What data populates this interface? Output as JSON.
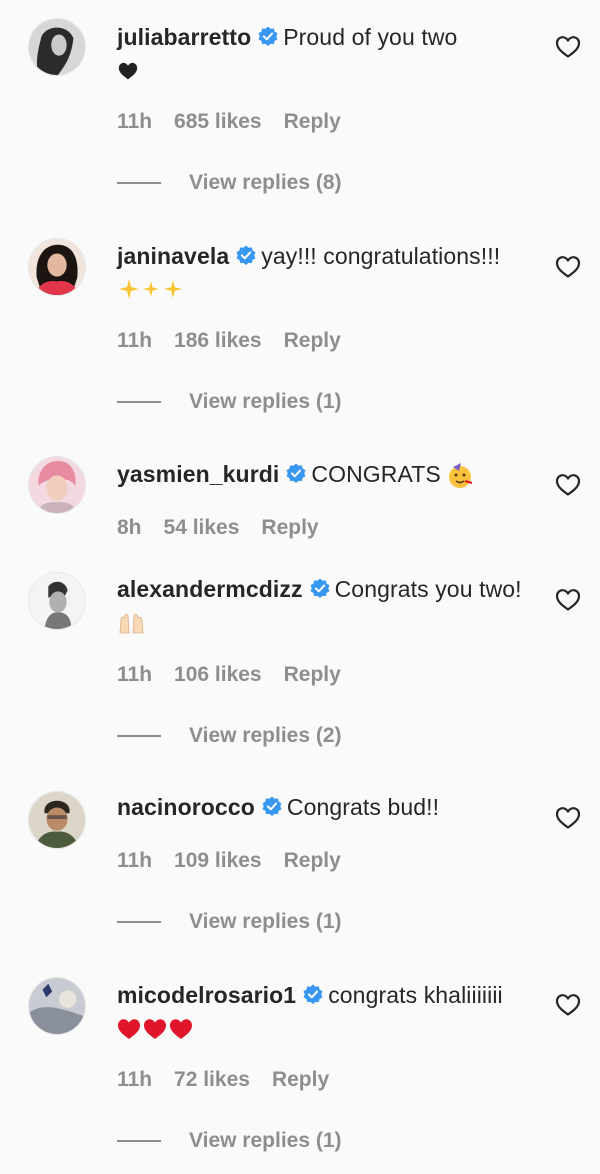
{
  "comments": [
    {
      "username": "juliabarretto",
      "text": "Proud of you two",
      "text_emoji": "black-heart-emoji",
      "time": "11h",
      "likes": "685 likes",
      "reply": "Reply",
      "view_replies": "View replies (8)"
    },
    {
      "username": "janinavela",
      "text": "yay!!! congratulations!!!",
      "text_emoji": "sparkles-emoji",
      "time": "11h",
      "likes": "186 likes",
      "reply": "Reply",
      "view_replies": "View replies (1)"
    },
    {
      "username": "yasmien_kurdi",
      "text": "CONGRATS",
      "text_emoji": "partying-face-emoji",
      "time": "8h",
      "likes": "54 likes",
      "reply": "Reply"
    },
    {
      "username": "alexandermcdizz",
      "text": "Congrats you two!",
      "text_emoji": "raising-hands-emoji",
      "time": "11h",
      "likes": "106 likes",
      "reply": "Reply",
      "view_replies": "View replies (2)"
    },
    {
      "username": "nacinorocco",
      "text": "Congrats bud!!",
      "time": "11h",
      "likes": "109 likes",
      "reply": "Reply",
      "view_replies": "View replies (1)"
    },
    {
      "username": "micodelrosario1",
      "text": "congrats khaliiiiiii",
      "text_emoji": "red-hearts-emoji",
      "time": "11h",
      "likes": "72 likes",
      "reply": "Reply",
      "view_replies": "View replies (1)"
    }
  ],
  "colors": {
    "background": "#fafafa",
    "text": "#262626",
    "secondary": "#8e8e8e",
    "verified": "#3897f0",
    "red_heart": "#e0152b"
  }
}
